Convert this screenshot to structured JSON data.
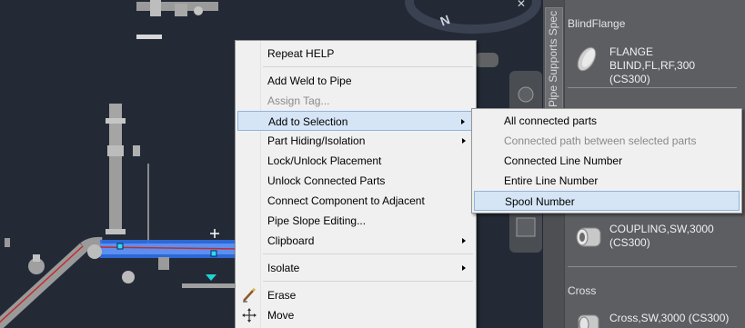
{
  "context_menu": {
    "items": [
      {
        "label": "Repeat HELP",
        "disabled": false
      },
      {
        "label": "Add Weld to Pipe",
        "disabled": false
      },
      {
        "label": "Assign Tag...",
        "disabled": true
      },
      {
        "label": "Add to Selection",
        "disabled": false,
        "submenu": true,
        "highlighted": true
      },
      {
        "label": "Part Hiding/Isolation",
        "disabled": false,
        "submenu": true
      },
      {
        "label": "Lock/Unlock Placement",
        "disabled": false
      },
      {
        "label": "Unlock Connected Parts",
        "disabled": false
      },
      {
        "label": "Connect Component to Adjacent",
        "disabled": false
      },
      {
        "label": "Pipe Slope Editing...",
        "disabled": false
      },
      {
        "label": "Clipboard",
        "disabled": false,
        "submenu": true
      },
      {
        "label": "Isolate",
        "disabled": false,
        "submenu": true
      },
      {
        "label": "Erase",
        "disabled": false,
        "icon": "eraser-icon"
      },
      {
        "label": "Move",
        "disabled": false,
        "icon": "move-icon"
      }
    ]
  },
  "submenu": {
    "items": [
      {
        "label": "All connected parts",
        "disabled": false
      },
      {
        "label": "Connected path between selected parts",
        "disabled": true
      },
      {
        "label": "Connected Line Number",
        "disabled": false
      },
      {
        "label": "Entire Line Number",
        "disabled": false
      },
      {
        "label": "Spool Number",
        "disabled": false,
        "highlighted": true
      }
    ]
  },
  "palette": {
    "tab_label": "Pipe Supports Spec",
    "sections": {
      "blind_flange": "BlindFlange",
      "cross": "Cross"
    },
    "items": {
      "flange_blind": {
        "line1": "FLANGE BLIND,FL,RF,300",
        "line2": "(CS300)",
        "icon": "blind-flange-icon"
      },
      "coupling": {
        "line1": "COUPLING,SW,3000",
        "line2": "(CS300)",
        "icon": "coupling-icon"
      },
      "cross": {
        "line1": "Cross,SW,3000 (CS300)",
        "icon": "cross-fitting-icon"
      }
    }
  },
  "colors": {
    "viewport_bg": "#232a36",
    "palette_bg": "#5c5e62",
    "menu_bg": "#f0f0f0",
    "menu_highlight": "#d5e5f6",
    "selected_pipe": "#2f6fe8"
  }
}
